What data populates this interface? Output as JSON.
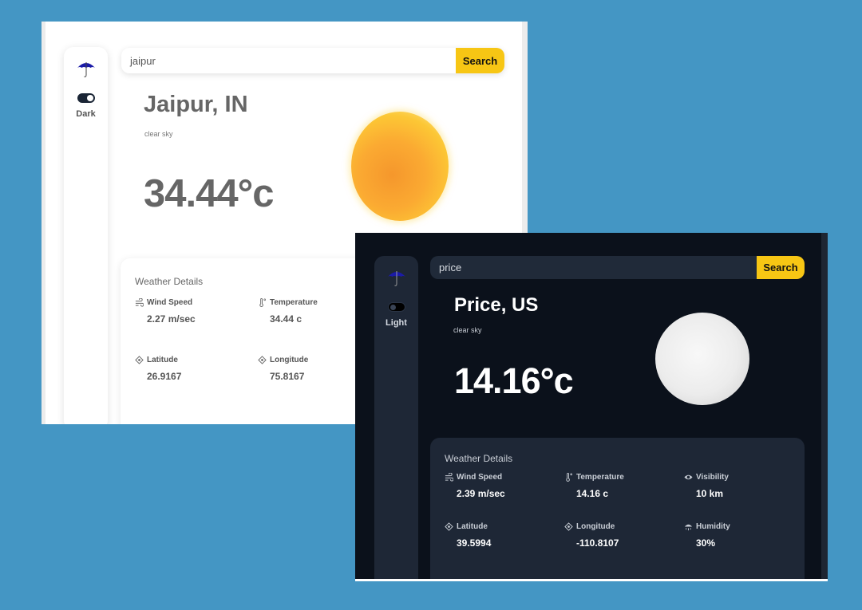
{
  "light_app": {
    "mode_label": "Dark",
    "search": {
      "value": "jaipur",
      "button": "Search"
    },
    "city": "Jaipur, IN",
    "description": "clear sky",
    "temperature": "34.44°c",
    "weather_icon": "sun-icon",
    "details": {
      "title": "Weather Details",
      "items": [
        {
          "label": "Wind Speed",
          "value": "2.27 m/sec",
          "icon": "wind-icon"
        },
        {
          "label": "Temperature",
          "value": "34.44 c",
          "icon": "thermometer-icon"
        },
        {
          "label": "Latitude",
          "value": "26.9167",
          "icon": "location-icon"
        },
        {
          "label": "Longitude",
          "value": "75.8167",
          "icon": "location-icon"
        }
      ]
    }
  },
  "dark_app": {
    "mode_label": "Light",
    "search": {
      "value": "price",
      "button": "Search"
    },
    "city": "Price, US",
    "description": "clear sky",
    "temperature": "14.16°c",
    "weather_icon": "moon-icon",
    "details": {
      "title": "Weather Details",
      "items": [
        {
          "label": "Wind Speed",
          "value": "2.39 m/sec",
          "icon": "wind-icon"
        },
        {
          "label": "Temperature",
          "value": "14.16 c",
          "icon": "thermometer-icon"
        },
        {
          "label": "Visibility",
          "value": "10 km",
          "icon": "eye-icon"
        },
        {
          "label": "Latitude",
          "value": "39.5994",
          "icon": "location-icon"
        },
        {
          "label": "Longitude",
          "value": "-110.8107",
          "icon": "location-icon"
        },
        {
          "label": "Humidity",
          "value": "30%",
          "icon": "humidity-icon"
        }
      ]
    }
  },
  "colors": {
    "background": "#4496c4",
    "accent": "#f7c614",
    "dark_bg": "#0b111b",
    "dark_panel": "#1e2736"
  }
}
